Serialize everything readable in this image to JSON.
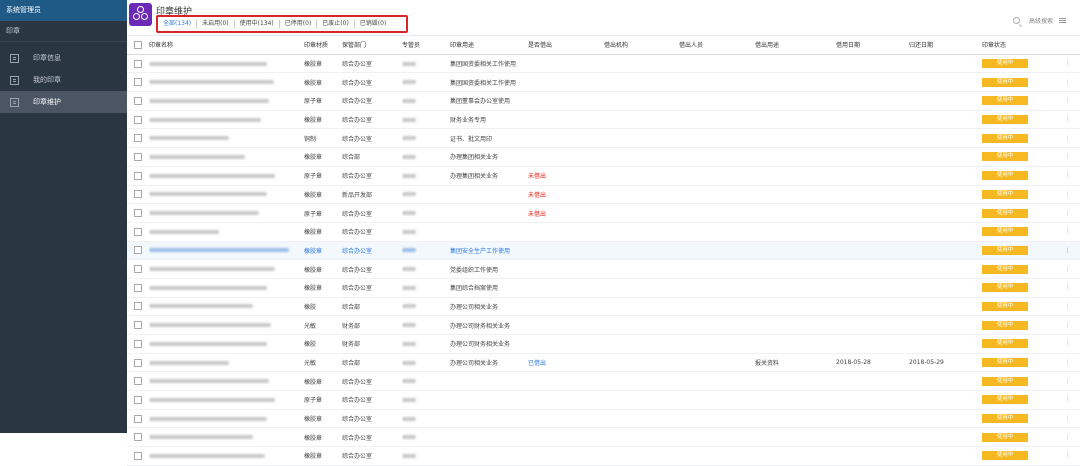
{
  "sidebar": {
    "top_title": "系统管理员",
    "section": "印章",
    "items": [
      {
        "label": "印章信息",
        "active": false
      },
      {
        "label": "我的印章",
        "active": false
      },
      {
        "label": "印章维护",
        "active": true
      }
    ]
  },
  "header": {
    "title": "印章维护",
    "filters": [
      "全部(134)",
      "未启用(0)",
      "使用中(134)",
      "已停用(0)",
      "已废止(0)",
      "已销毁(0)"
    ],
    "active_filter": 0,
    "advanced_search": "高级搜索"
  },
  "table": {
    "columns": [
      "印章名称",
      "印章材质",
      "保管部门",
      "专管员",
      "印章用途",
      "是否借出",
      "借出机构",
      "借出人员",
      "借出用途",
      "借用日期",
      "归还日期",
      "印章状态"
    ],
    "rows": [
      {
        "material": "橡胶章",
        "dept": "综合办公室",
        "usage": "集团国资委相关工作使用",
        "lent": "",
        "lend_org": "",
        "lender": "",
        "lend_use": "",
        "borrow": "",
        "return": "",
        "status": "使用中"
      },
      {
        "material": "橡胶章",
        "dept": "综合办公室",
        "usage": "集团国资委相关工作使用",
        "lent": "",
        "lend_org": "",
        "lender": "",
        "lend_use": "",
        "borrow": "",
        "return": "",
        "status": "使用中"
      },
      {
        "material": "原子章",
        "dept": "综合办公室",
        "usage": "集团董事会办公室使用",
        "lent": "",
        "lend_org": "",
        "lender": "",
        "lend_use": "",
        "borrow": "",
        "return": "",
        "status": "使用中"
      },
      {
        "material": "橡胶章",
        "dept": "综合办公室",
        "usage": "财务业务专用",
        "lent": "",
        "lend_org": "",
        "lender": "",
        "lend_use": "",
        "borrow": "",
        "return": "",
        "status": "使用中"
      },
      {
        "material": "铜制",
        "dept": "综合办公室",
        "usage": "证书、批文用印",
        "lent": "",
        "lend_org": "",
        "lender": "",
        "lend_use": "",
        "borrow": "",
        "return": "",
        "status": "使用中"
      },
      {
        "material": "橡胶章",
        "dept": "综合部",
        "usage": "办理集团相关业务",
        "lent": "",
        "lend_org": "",
        "lender": "",
        "lend_use": "",
        "borrow": "",
        "return": "",
        "status": "使用中"
      },
      {
        "material": "原子章",
        "dept": "综合办公室",
        "usage": "办理集团相关业务",
        "lent": "未借出",
        "lend_org": "",
        "lender": "",
        "lend_use": "",
        "borrow": "",
        "return": "",
        "status": "使用中"
      },
      {
        "material": "橡胶章",
        "dept": "新品开发部",
        "usage": "",
        "lent": "未借出",
        "lend_org": "",
        "lender": "",
        "lend_use": "",
        "borrow": "",
        "return": "",
        "status": "使用中"
      },
      {
        "material": "原子章",
        "dept": "综合办公室",
        "usage": "",
        "lent": "未借出",
        "lend_org": "",
        "lender": "",
        "lend_use": "",
        "borrow": "",
        "return": "",
        "status": "使用中"
      },
      {
        "material": "橡胶章",
        "dept": "综合办公室",
        "usage": "",
        "lent": "",
        "lend_org": "",
        "lender": "",
        "lend_use": "",
        "borrow": "",
        "return": "",
        "status": "使用中"
      },
      {
        "material": "橡胶章",
        "dept": "综合办公室",
        "usage": "集团安全生产工作使用",
        "lent": "",
        "lend_org": "",
        "lender": "",
        "lend_use": "",
        "borrow": "",
        "return": "",
        "status": "使用中",
        "hl": true
      },
      {
        "material": "橡胶章",
        "dept": "综合办公室",
        "usage": "党委组织工作使用",
        "lent": "",
        "lend_org": "",
        "lender": "",
        "lend_use": "",
        "borrow": "",
        "return": "",
        "status": "使用中"
      },
      {
        "material": "橡胶章",
        "dept": "综合办公室",
        "usage": "集团综合档案使用",
        "lent": "",
        "lend_org": "",
        "lender": "",
        "lend_use": "",
        "borrow": "",
        "return": "",
        "status": "使用中"
      },
      {
        "material": "橡胶",
        "dept": "综合部",
        "usage": "办理公司相关业务",
        "lent": "",
        "lend_org": "",
        "lender": "",
        "lend_use": "",
        "borrow": "",
        "return": "",
        "status": "使用中"
      },
      {
        "material": "光敏",
        "dept": "财务部",
        "usage": "办理公司财务相关业务",
        "lent": "",
        "lend_org": "",
        "lender": "",
        "lend_use": "",
        "borrow": "",
        "return": "",
        "status": "使用中"
      },
      {
        "material": "橡胶",
        "dept": "财务部",
        "usage": "办理公司财务相关业务",
        "lent": "",
        "lend_org": "",
        "lender": "",
        "lend_use": "",
        "borrow": "",
        "return": "",
        "status": "使用中"
      },
      {
        "material": "光敏",
        "dept": "综合部",
        "usage": "办理公司相关业务",
        "lent": "已借出",
        "lend_org": "",
        "lender": "",
        "lend_use": "报关资料",
        "borrow": "2018-05-28",
        "return": "2018-05-29",
        "status": "使用中"
      },
      {
        "material": "橡胶章",
        "dept": "综合办公室",
        "usage": "",
        "lent": "",
        "lend_org": "",
        "lender": "",
        "lend_use": "",
        "borrow": "",
        "return": "",
        "status": "使用中"
      },
      {
        "material": "原子章",
        "dept": "综合办公室",
        "usage": "",
        "lent": "",
        "lend_org": "",
        "lender": "",
        "lend_use": "",
        "borrow": "",
        "return": "",
        "status": "使用中"
      },
      {
        "material": "橡胶章",
        "dept": "综合办公室",
        "usage": "",
        "lent": "",
        "lend_org": "",
        "lender": "",
        "lend_use": "",
        "borrow": "",
        "return": "",
        "status": "使用中"
      },
      {
        "material": "橡胶章",
        "dept": "综合办公室",
        "usage": "",
        "lent": "",
        "lend_org": "",
        "lender": "",
        "lend_use": "",
        "borrow": "",
        "return": "",
        "status": "使用中"
      },
      {
        "material": "橡胶章",
        "dept": "综合办公室",
        "usage": "",
        "lent": "",
        "lend_org": "",
        "lender": "",
        "lend_use": "",
        "borrow": "",
        "return": "",
        "status": "使用中"
      }
    ]
  },
  "colors": {
    "sidebar_bg": "#2b3643",
    "sidebar_top": "#1f5a86",
    "accent": "#2a7ae2",
    "status": "#f6b921",
    "alert": "#e2231a"
  },
  "icons": {
    "app": "seal-icon",
    "search": "search-icon",
    "list": "list-icon",
    "row_menu": "more-icon"
  }
}
